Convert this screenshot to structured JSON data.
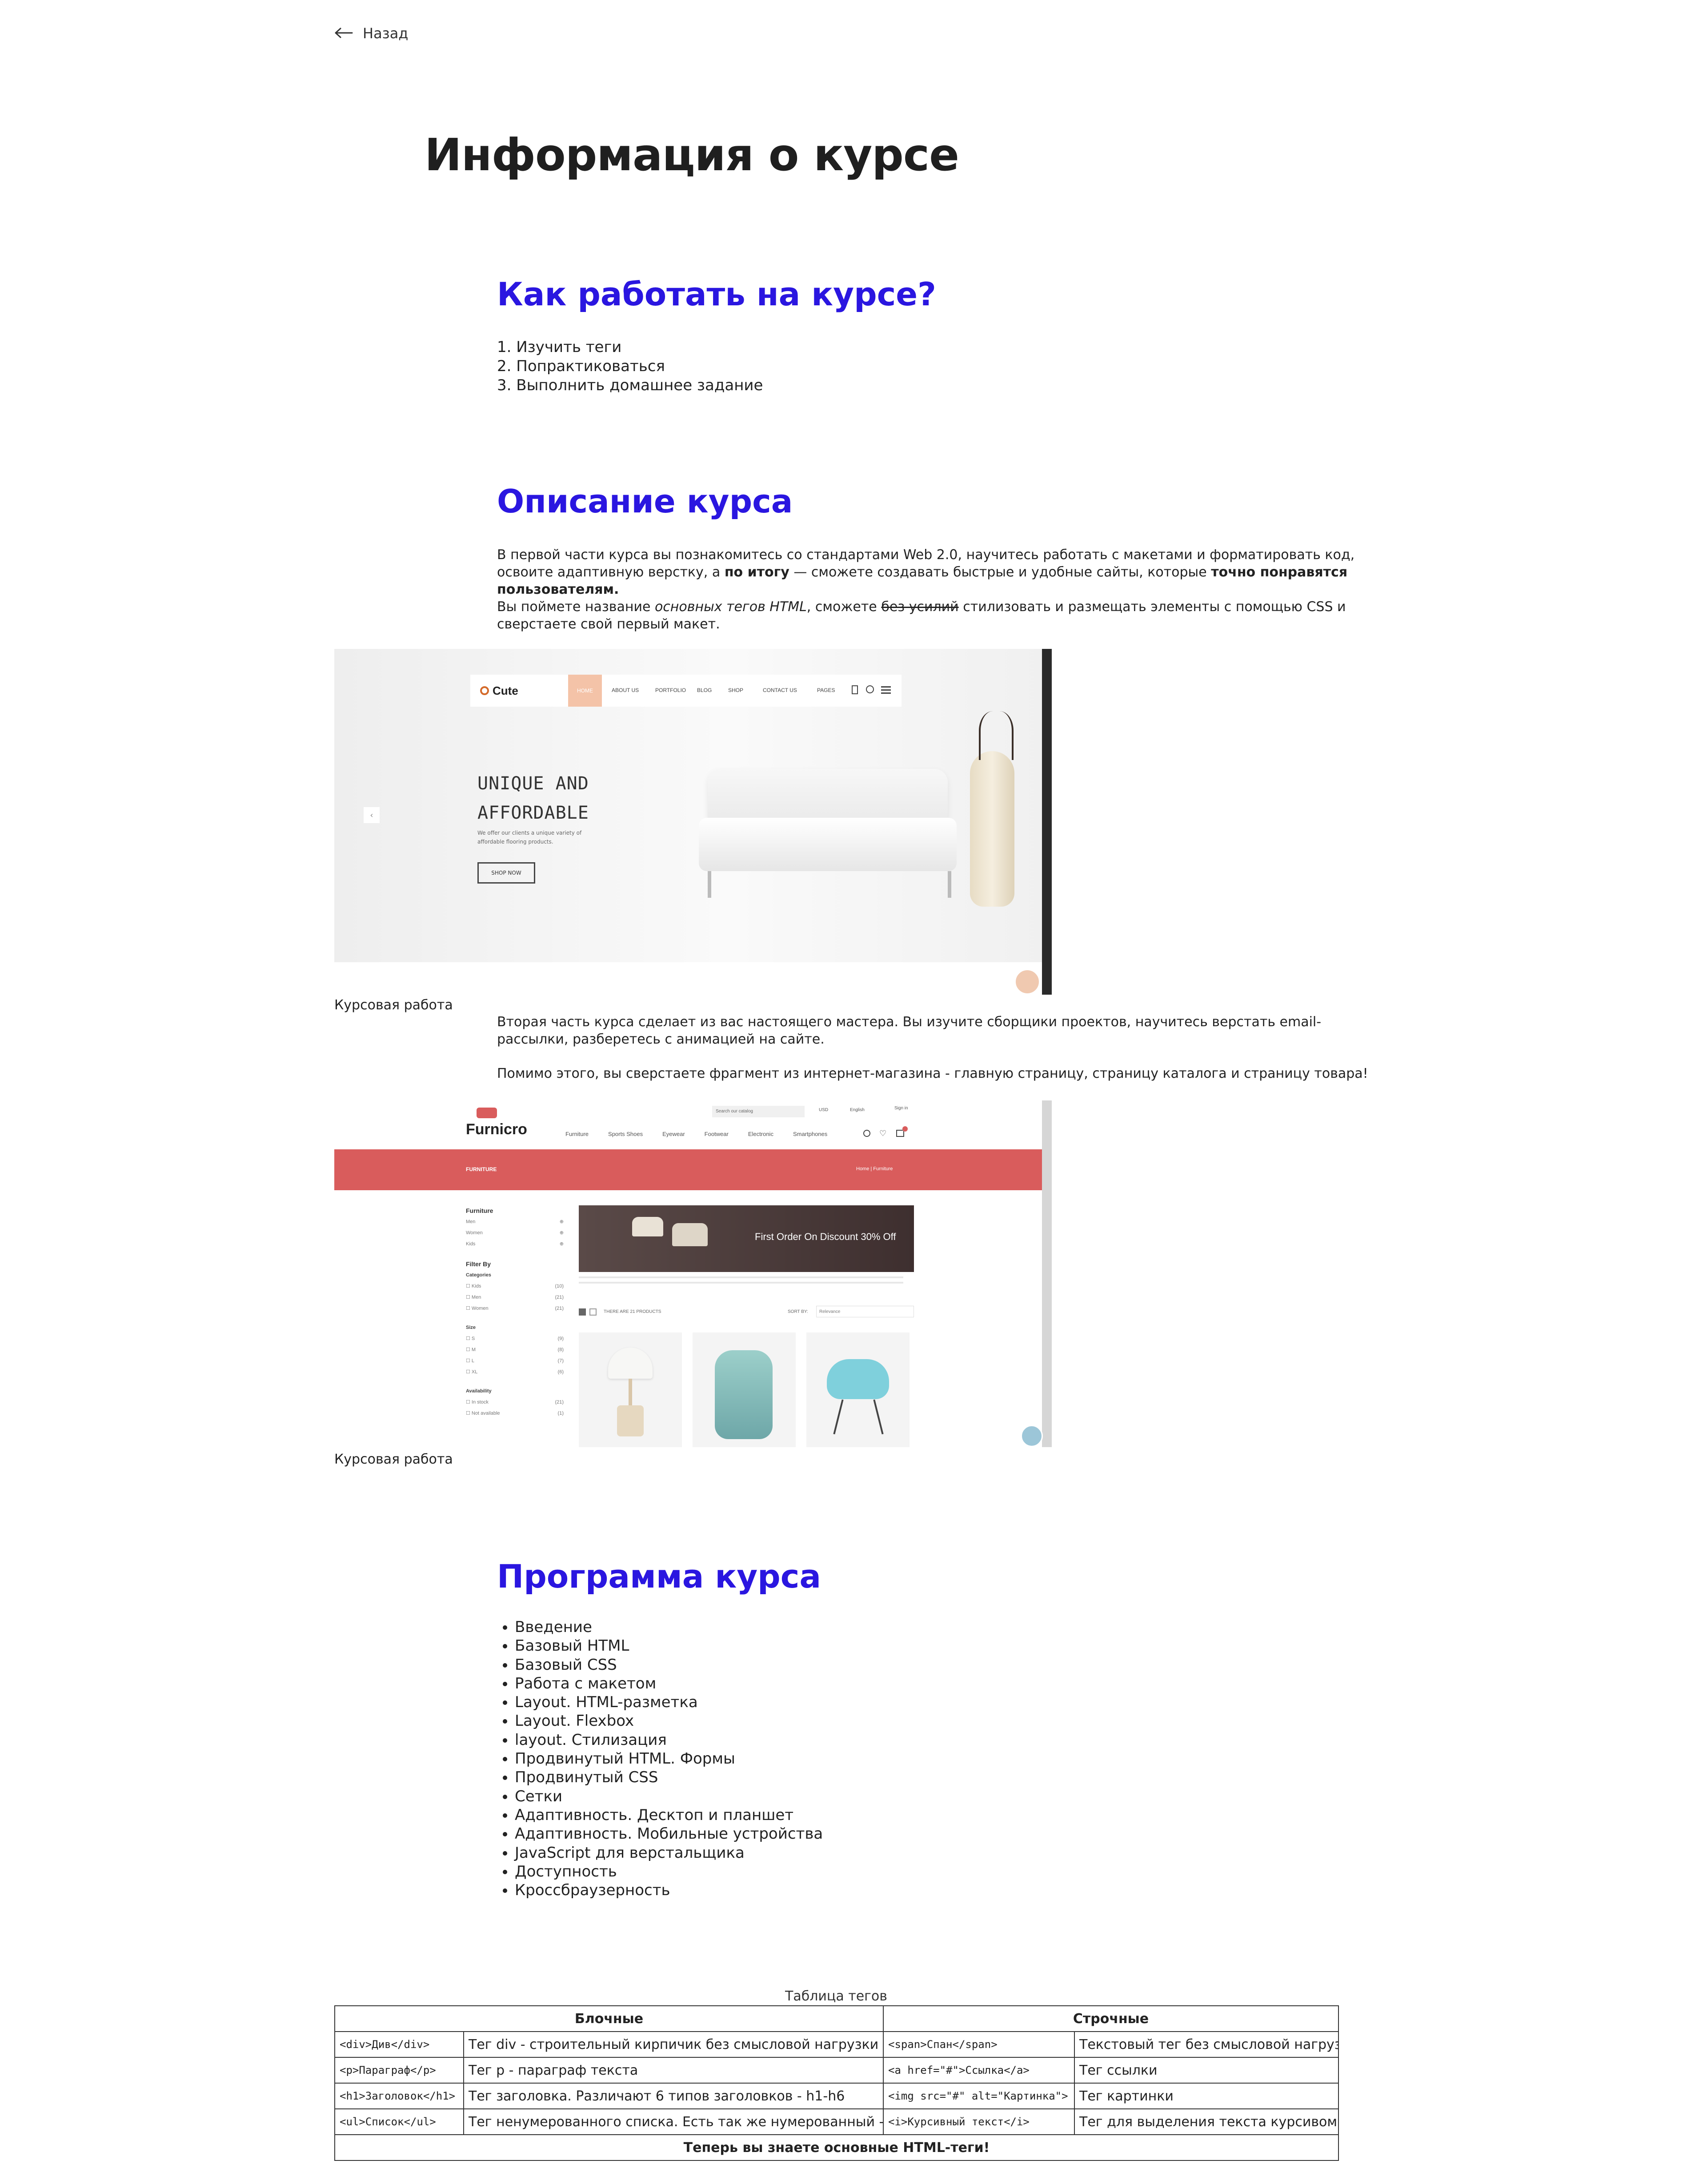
{
  "nav": {
    "back_label": "Назад"
  },
  "page_title": "Информация о курсе",
  "how_to": {
    "title": "Как работать на курсе?",
    "steps": [
      "1. Изучить теги",
      "2. Попрактиковаться",
      "3. Выполнить домашнее задание"
    ]
  },
  "description": {
    "title": "Описание курса",
    "p1_a": "В первой части курса вы познакомитесь со стандартами Web 2.0, научитесь работать с макетами и форматировать код, освоите адаптивную верстку, а ",
    "p1_bold1": "по итогу",
    "p1_b": " — сможете создавать быстрые и удобные сайты, которые ",
    "p1_bold2": "точно понравятся пользователям.",
    "p2_a": "Вы поймете название ",
    "p2_italic": "основных тегов HTML",
    "p2_b": ", сможете ",
    "p2_strike": "без усилий",
    "p2_c": " стилизовать и размещать элементы с помощью CSS и сверстаете свой первый макет.",
    "p3": "Вторая часть курса сделает из вас настоящего мастера. Вы изучите сборщики проектов, научитесь верстать email-рассылки, разберетесь с анимацией на сайте.",
    "p4": "Помимо этого, вы сверстаете фрагмент из интернет-магазина - главную страницу, страницу каталога и страницу товара!",
    "caption1": "Курсовая работа",
    "caption2": "Курсовая работа"
  },
  "shot1": {
    "logo": "Cute",
    "nav": [
      "HOME",
      "ABOUT US",
      "PORTFOLIO",
      "BLOG",
      "SHOP",
      "CONTACT US",
      "PAGES"
    ],
    "hero_line1": "UNIQUE AND",
    "hero_line2": "AFFORDABLE",
    "hero_sub1": "We offer our clients a unique variety of",
    "hero_sub2": "affordable flooring products.",
    "cta": "SHOP NOW",
    "accent_color": "#f4c3a8"
  },
  "shot2": {
    "search_placeholder": "Search our catalog",
    "currency": "USD",
    "language": "English",
    "signin": "Sign in",
    "logo": "Furnicro",
    "nav": [
      "Furniture",
      "Sports Shoes",
      "Eyewear",
      "Footwear",
      "Electronic",
      "Smartphones"
    ],
    "banner_title": "FURNITURE",
    "breadcrumb": "Home  |  Furniture",
    "sidebar_title": "Furniture",
    "sidebar_items": [
      "Men",
      "Women",
      "Kids"
    ],
    "filter_title": "Filter By",
    "categories_title": "Categories",
    "categories": [
      "Kids",
      "Men",
      "Women"
    ],
    "category_counts": [
      "(10)",
      "(21)",
      "(21)"
    ],
    "size_title": "Size",
    "sizes": [
      "S",
      "M",
      "L",
      "XL"
    ],
    "size_counts": [
      "(9)",
      "(8)",
      "(7)",
      "(6)"
    ],
    "availability_title": "Availability",
    "availability": [
      "In stock",
      "Not available"
    ],
    "availability_counts": [
      "(21)",
      "(1)"
    ],
    "promo": "First Order On Discount 30% Off",
    "products_count": "THERE ARE 21 PRODUCTS",
    "sort_label": "SORT BY:",
    "sort_value": "Relevance",
    "brand_color": "#d95c5c"
  },
  "program": {
    "title": "Программа курса",
    "items": [
      "Введение",
      "Базовый HTML",
      "Базовый CSS",
      "Работа с макетом",
      "Layout. HTML-разметка",
      "Layout. Flexbox",
      "layout. Стилизация",
      "Продвинутый HTML. Формы",
      "Продвинутый CSS",
      "Сетки",
      "Адаптивность. Десктоп и планшет",
      "Адаптивность. Мобильные устройства",
      "JavaScript для верстальщика",
      "Доступность",
      "Кроссбраузерность"
    ]
  },
  "table": {
    "caption": "Таблица тегов",
    "head_block": "Блочные",
    "head_inline": "Строчные",
    "rows": [
      {
        "b_code": "<div>Див</div>",
        "b_desc": "Тег div - строительный кирпичик без смысловой нагрузки",
        "i_code": "<span>Спан</span>",
        "i_desc": "Текстовый тег без смысловой нагрузки"
      },
      {
        "b_code": "<p>Параграф</p>",
        "b_desc": "Тег p - параграф текста",
        "i_code": "<a href=\"#\">Ссылка</a>",
        "i_desc": "Тег ссылки"
      },
      {
        "b_code": "<h1>Заголовок</h1>",
        "b_desc": "Тег заголовка. Различают 6 типов заголовков - h1-h6",
        "i_code": "<img src=\"#\" alt=\"Картинка\">",
        "i_desc": "Тег картинки"
      },
      {
        "b_code": "<ul>Список</ul>",
        "b_desc": "Тег ненумерованного списка. Есть так же нумерованный - ol",
        "i_code": "<i>Курсивный текст</i>",
        "i_desc": "Тег для выделения текста курсивом"
      }
    ],
    "footer": "Теперь вы знаете основные HTML-теги!"
  }
}
